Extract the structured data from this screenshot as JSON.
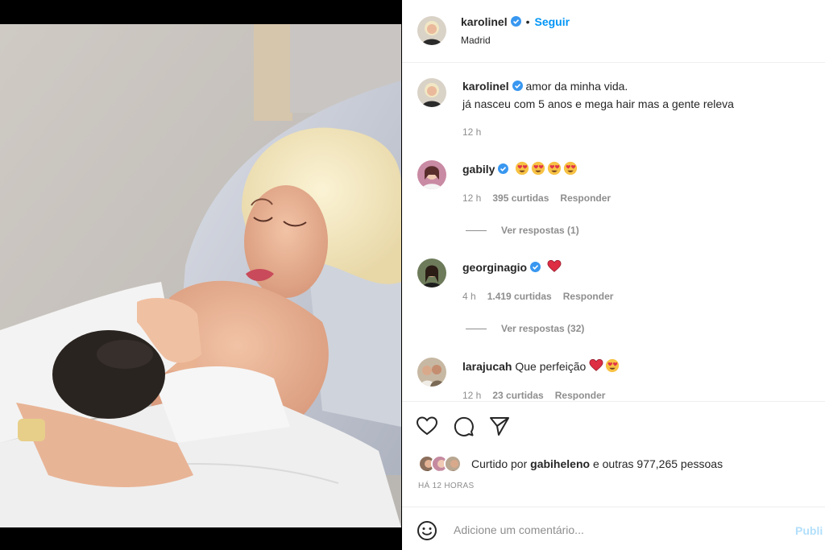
{
  "post": {
    "author": "karolinel",
    "follow_label": "Seguir",
    "location": "Madrid",
    "more_label": "·"
  },
  "caption": {
    "username": "karolinel",
    "line1": "amor da minha vida.",
    "line2": "já nasceu com 5 anos e mega hair mas a gente releva",
    "time": "12 h"
  },
  "comments": [
    {
      "username": "gabily",
      "text": "",
      "emojis": [
        "heart-eyes",
        "heart-eyes",
        "heart-eyes",
        "heart-eyes"
      ],
      "time": "12 h",
      "likes": "395 curtidas",
      "reply": "Responder",
      "view_replies": "Ver respostas (1)"
    },
    {
      "username": "georginagio",
      "text": "",
      "emojis": [
        "red-heart"
      ],
      "time": "4 h",
      "likes": "1.419 curtidas",
      "reply": "Responder",
      "view_replies": "Ver respostas (32)"
    },
    {
      "username": "larajucah",
      "text": "Que perfeição",
      "emojis": [
        "red-heart",
        "heart-eyes"
      ],
      "time": "12 h",
      "likes": "23 curtidas",
      "reply": "Responder"
    }
  ],
  "actions": {
    "icons": [
      "heart-icon",
      "comment-icon",
      "share-icon"
    ]
  },
  "likes": {
    "prefix": "Curtido por",
    "user": "gabiheleno",
    "suffix": "e outras 977,265 pessoas"
  },
  "time_ago": "HÁ 12 HORAS",
  "composer": {
    "placeholder": "Adicione um comentário...",
    "publish_label": "Publi"
  },
  "colors": {
    "accent": "#0095f6",
    "verified": "#3897f0",
    "muted": "#8e8e8e",
    "heart": "#ed4956"
  }
}
